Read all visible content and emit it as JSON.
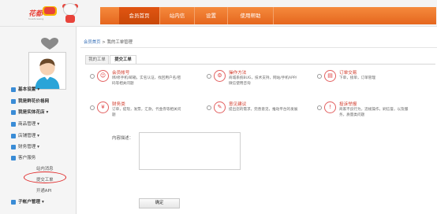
{
  "header": {
    "logo_text": "花都",
    "logo_sub": "huaduwang",
    "nav": [
      {
        "label": "会员首页",
        "active": true
      },
      {
        "label": "站内信",
        "active": false
      },
      {
        "label": "设置",
        "active": false
      },
      {
        "label": "使用帮助",
        "active": false
      }
    ]
  },
  "sidebar": {
    "items": [
      {
        "label": "基本设置",
        "arrow": "▾"
      },
      {
        "label": "我是鲜花价格网",
        "arrow": ""
      },
      {
        "label": "我是实体花店",
        "arrow": "▾"
      },
      {
        "label": "商品管理",
        "arrow": "▾"
      },
      {
        "label": "店铺管理",
        "arrow": "▾"
      },
      {
        "label": "财务管理",
        "arrow": "▾"
      },
      {
        "label": "客户服务",
        "arrow": ""
      }
    ],
    "sub_items": [
      "站内消息",
      "提交工单",
      "开通API"
    ],
    "last_item": {
      "label": "子帐户管理",
      "arrow": "▾"
    }
  },
  "main": {
    "breadcrumb": {
      "link": "会员首页",
      "sep": ">",
      "current": "我的工单管理"
    },
    "tabs": [
      {
        "label": "我的工单",
        "active": false
      },
      {
        "label": "提交工单",
        "active": true
      }
    ],
    "options": [
      {
        "title": "会员帐号",
        "desc": "绑/修手机/邮箱，实名认证，找回用户名/密码等相关问题",
        "icon": "user-icon",
        "glyph": "☺"
      },
      {
        "title": "操作方法",
        "desc": "商城系统BUG，技术支持，网站/手机APP/微信使用咨询",
        "icon": "gear-icon",
        "glyph": "⚙"
      },
      {
        "title": "订单交易",
        "desc": "下单，接单，订单管理",
        "icon": "clipboard-icon",
        "glyph": "▤"
      },
      {
        "title": "财务类",
        "desc": "订单，提现，发票，汇款，代金券等相关问题",
        "icon": "money-icon",
        "glyph": "¥"
      },
      {
        "title": "意见建议",
        "desc": "提出您的需求，完善意见，推动平台的发展",
        "icon": "chat-icon",
        "glyph": "✎"
      },
      {
        "title": "投诉举报",
        "desc": "商家不良行为，违规操作，刷信誉，以及服务，质量类问题",
        "icon": "megaphone-icon",
        "glyph": "!"
      }
    ],
    "content_label": "内容描述：",
    "content_value": "",
    "submit_label": "确定"
  }
}
